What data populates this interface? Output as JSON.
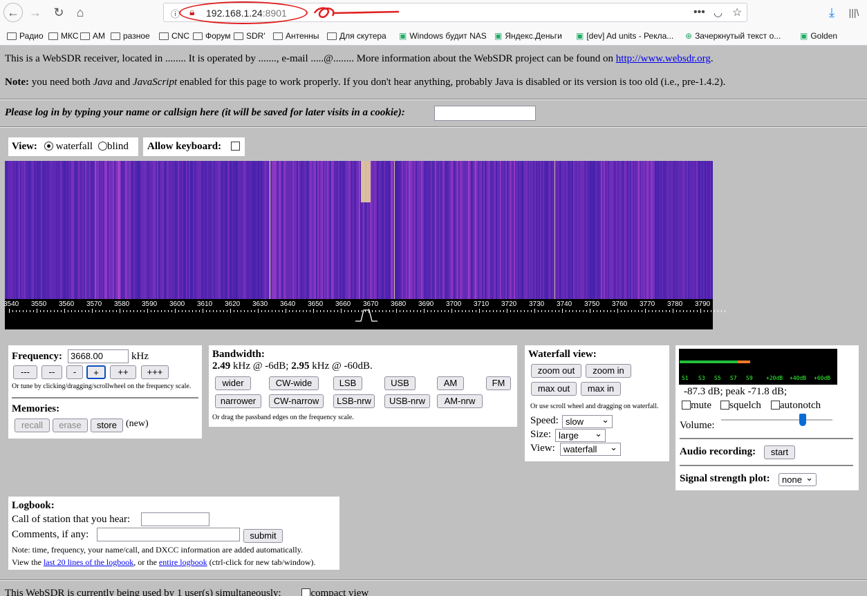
{
  "browser": {
    "url_host": "192.168.1.24",
    "url_port": ":8901",
    "bookmarks": [
      {
        "label": "Радио",
        "icon": "folder-icon"
      },
      {
        "label": "МКС",
        "icon": "folder-icon"
      },
      {
        "label": "AM",
        "icon": "folder-icon"
      },
      {
        "label": "разное",
        "icon": "folder-icon"
      },
      {
        "label": "CNC",
        "icon": "folder-icon"
      },
      {
        "label": "Форум",
        "icon": "folder-icon"
      },
      {
        "label": "SDR'",
        "icon": "folder-icon"
      },
      {
        "label": "Антенны",
        "icon": "folder-icon"
      },
      {
        "label": "Для скутера",
        "icon": "folder-icon"
      },
      {
        "label": "Windows будит NAS",
        "icon": "site-icon"
      },
      {
        "label": "Яндекс.Деньги",
        "icon": "site-icon"
      },
      {
        "label": "[dev] Ad units - Рекла...",
        "icon": "site-icon"
      },
      {
        "label": "Зачеркнутый текст о...",
        "icon": "globe-icon"
      },
      {
        "label": "Golden",
        "icon": "site-icon"
      }
    ]
  },
  "intro": {
    "line1_pre": "This is a WebSDR receiver, located in ........ It is operated by ......., e-mail .....@........ More information about the WebSDR project can be found on ",
    "line1_link": "http://www.websdr.org",
    "line1_post": ".",
    "note_label": "Note:",
    "note_a": " you need both ",
    "note_java": "Java",
    "note_and": " and ",
    "note_js": "JavaScript",
    "note_b": " enabled for this page to work properly. If you don't hear anything, probably Java is disabled or its version is too old (i.e., pre-1.4.2)."
  },
  "login": {
    "label": "Please log in by typing your name or callsign here (it will be saved for later visits in a cookie):",
    "value": ""
  },
  "view": {
    "label": "View:",
    "waterfall": "waterfall",
    "blind": "blind",
    "allow_keyboard": "Allow keyboard:"
  },
  "scale": {
    "ticks": [
      "3540",
      "3550",
      "3560",
      "3570",
      "3580",
      "3590",
      "3600",
      "3610",
      "3620",
      "3630",
      "3640",
      "3650",
      "3660",
      "3670",
      "3680",
      "3690",
      "3700",
      "3710",
      "3720",
      "3730",
      "3740",
      "3750",
      "3760",
      "3770",
      "3780",
      "3790"
    ]
  },
  "frequency": {
    "label": "Frequency:",
    "value": "3668.00",
    "unit": "kHz",
    "steps": [
      "---",
      "--",
      "-",
      "+",
      "++",
      "+++"
    ],
    "hint": "Or tune by clicking/dragging/scrollwheel on the frequency scale.",
    "memories_label": "Memories:",
    "recall": "recall",
    "erase": "erase",
    "store": "store",
    "new": "(new)"
  },
  "bandwidth": {
    "label": "Bandwidth:",
    "bw1": "2.49",
    "bw1_text": " kHz @ -6dB; ",
    "bw2": "2.95",
    "bw2_text": " kHz @ -60dB.",
    "row1": [
      "wider",
      "CW-wide",
      "LSB",
      "USB",
      "AM",
      "FM"
    ],
    "row2": [
      "narrower",
      "CW-narrow",
      "LSB-nrw",
      "USB-nrw",
      "AM-nrw"
    ],
    "hint": "Or drag the passband edges on the frequency scale."
  },
  "waterfall_view": {
    "label": "Waterfall view:",
    "zoom_out": "zoom out",
    "zoom_in": "zoom in",
    "max_out": "max out",
    "max_in": "max in",
    "hint": "Or use scroll wheel and dragging on waterfall.",
    "speed_label": "Speed:",
    "speed": "slow",
    "size_label": "Size:",
    "size": "large",
    "view_label": "View:",
    "view": "waterfall"
  },
  "smeter": {
    "labels": [
      "S1",
      "S3",
      "S5",
      "S7",
      "S9",
      "+20dB",
      "+40dB",
      "+60dB"
    ],
    "level_green": 0.37,
    "level_orange": 0.08,
    "readout": "-87.3 dB; peak   -71.8 dB;",
    "mute": "mute",
    "squelch": "squelch",
    "autonotch": "autonotch",
    "volume_label": "Volume:",
    "volume": 0.73,
    "recording_label": "Audio recording:",
    "recording_btn": "start",
    "plot_label": "Signal strength plot:",
    "plot_value": "none"
  },
  "logbook": {
    "label": "Logbook:",
    "call_label": "Call of station that you hear:",
    "comments_label": "Comments, if any:",
    "submit": "submit",
    "note": "Note: time, frequency, your name/call, and DXCC information are added automatically.",
    "view_pre": "View the ",
    "link1": "last 20 lines of the logbook",
    "view_mid": ", or the ",
    "link2": "entire logbook",
    "view_post": " (ctrl-click for new tab/window)."
  },
  "footer": {
    "users": "This WebSDR is currently being used by 1 user(s) simultaneously:",
    "compact": "compact view"
  },
  "colors": {
    "accent_red": "#e02020",
    "link": "#0000ee",
    "waterfall_bg": "#3b1ea8",
    "meter_green": "#22c03a",
    "meter_orange": "#f07a2a"
  }
}
